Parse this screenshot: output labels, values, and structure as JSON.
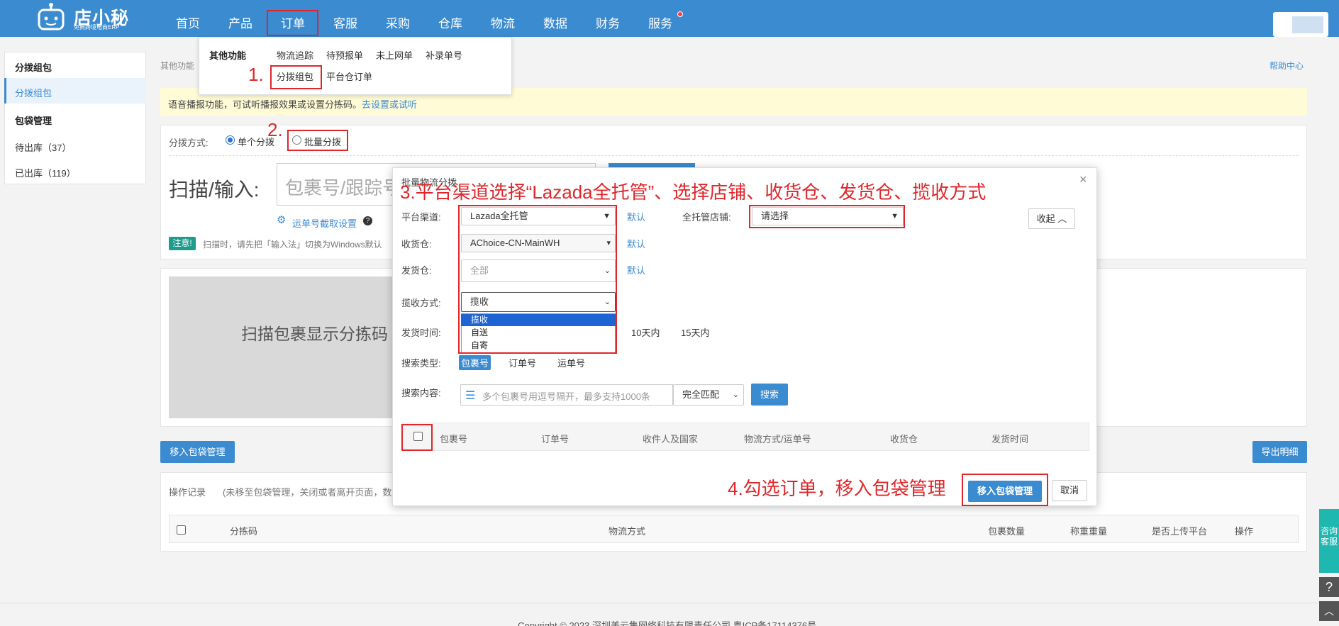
{
  "brand": {
    "name": "店小秘",
    "tagline": "免费跨境电商ERP"
  },
  "nav": [
    {
      "label": "首页"
    },
    {
      "label": "产品"
    },
    {
      "label": "订单"
    },
    {
      "label": "客服"
    },
    {
      "label": "采购"
    },
    {
      "label": "仓库"
    },
    {
      "label": "物流"
    },
    {
      "label": "数据"
    },
    {
      "label": "财务"
    },
    {
      "label": "服务"
    }
  ],
  "menu": {
    "heading": "其他功能",
    "items": [
      "物流追踪",
      "待预报单",
      "未上网单",
      "补录单号",
      "分拨组包",
      "平台仓订单"
    ]
  },
  "sidebar": {
    "group1": "分拨组包",
    "item_active": "分拨组包",
    "group2": "包袋管理",
    "item_pending": "待出库（37）",
    "item_done": "已出库（119）"
  },
  "breadcrumb": "其他功能",
  "help_center": "帮助中心",
  "notice": {
    "text": "语音播报功能，可试听播报效果或设置分拣码。",
    "link": "去设置或试听"
  },
  "mode": {
    "label": "分拨方式:",
    "single": "单个分拨",
    "batch": "批量分拨"
  },
  "scan": {
    "label": "扫描/输入:",
    "placeholder": "包裹号/跟踪号",
    "setting": "运单号截取设置",
    "note_badge": "注意!",
    "note_text": "扫描时，请先把「输入法」切换为Windows默认"
  },
  "sort_code_text": "扫描包裹显示分拣码",
  "buttons": {
    "move_to_bag": "移入包袋管理",
    "export": "导出明细",
    "search": "搜索",
    "cancel": "取消",
    "collapse": "收起"
  },
  "record": {
    "title": "操作记录",
    "note": "(未移至包袋管理，关闭或者离开页面，数",
    "columns": [
      "分拣码",
      "物流方式",
      "包裹数量",
      "称重重量",
      "是否上传平台",
      "操作"
    ]
  },
  "footer": "Copyright © 2023 深圳美云集网络科技有限责任公司 粤ICP备17114376号",
  "float": {
    "consult": "咨询客服",
    "help": "?",
    "top": "︿"
  },
  "modal": {
    "title": "批量物流分拨",
    "platform_label": "平台渠道:",
    "platform_value": "Lazada全托管",
    "default": "默认",
    "store_label": "全托管店铺:",
    "store_value": "请选择",
    "receive_label": "收货仓:",
    "receive_value": "AChoice-CN-MainWH",
    "ship_label": "发货仓:",
    "ship_value": "全部",
    "pickup_label": "揽收方式:",
    "pickup_value": "揽收",
    "pickup_options": [
      "揽收",
      "自送",
      "自寄"
    ],
    "time_label": "发货时间:",
    "time_options": [
      "10天内",
      "15天内"
    ],
    "search_type_label": "搜索类型:",
    "search_types": [
      "包裹号",
      "订单号",
      "运单号"
    ],
    "search_content_label": "搜索内容:",
    "search_placeholder": "多个包裹号用逗号隔开，最多支持1000条",
    "match_value": "完全匹配",
    "columns": [
      "包裹号",
      "订单号",
      "收件人及国家",
      "物流方式/运单号",
      "收货仓",
      "发货时间"
    ]
  },
  "annotations": {
    "step1": "1.",
    "step2": "2.",
    "step3": "3.平台渠道选择“Lazada全托管”、选择店铺、收货仓、发货仓、揽收方式",
    "step4": "4.勾选订单，移入包袋管理"
  }
}
